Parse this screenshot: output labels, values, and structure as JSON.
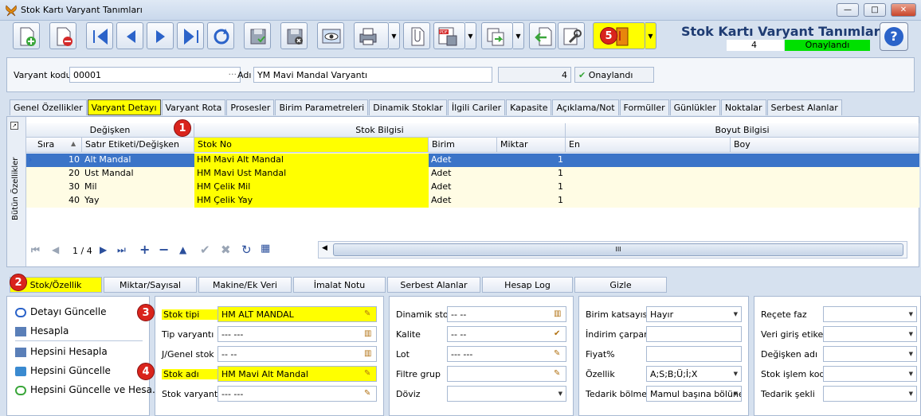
{
  "window": {
    "title": "Stok Kartı Varyant Tanımları",
    "min": "—",
    "max": "□",
    "close": "✕"
  },
  "header": {
    "title": "Stok Kartı Varyant Tanımları",
    "count": "4",
    "status": "Onaylandı",
    "help": "?"
  },
  "form": {
    "code_label": "Varyant kodu",
    "code_value": "00001",
    "name_label": "Adı",
    "name_value": "YM Mavi Mandal Varyantı",
    "count_value": "4",
    "approved_label": "Onaylandı",
    "ellipsis": "···"
  },
  "tabs": [
    "Genel Özellikler",
    "Varyant Detayı",
    "Varyant Rota",
    "Prosesler",
    "Birim Parametreleri",
    "Dinamik Stoklar",
    "İlgili Cariler",
    "Kapasite",
    "Açıklama/Not",
    "Formüller",
    "Günlükler",
    "Noktalar",
    "Serbest Alanlar"
  ],
  "grid": {
    "side_label": "Bütün Özellikler",
    "band_degisken": "Değişken",
    "band_stok": "Stok Bilgisi",
    "band_boyut": "Boyut Bilgisi",
    "col_sira": "Sıra",
    "col_satir": "Satır Etiketi/Değişken",
    "col_stokno": "Stok No",
    "col_birim": "Birim",
    "col_miktar": "Miktar",
    "col_en": "En",
    "col_boy": "Boy",
    "rows": [
      {
        "sira": "10",
        "etiket": "Alt Mandal",
        "stokno": "HM Mavi Alt Mandal",
        "birim": "Adet",
        "miktar": "1"
      },
      {
        "sira": "20",
        "etiket": "Ust Mandal",
        "stokno": "HM Mavi Ust Mandal",
        "birim": "Adet",
        "miktar": "1"
      },
      {
        "sira": "30",
        "etiket": "Mil",
        "stokno": "HM Çelik Mil",
        "birim": "Adet",
        "miktar": "1"
      },
      {
        "sira": "40",
        "etiket": "Yay",
        "stokno": "HM Çelik Yay",
        "birim": "Adet",
        "miktar": "1"
      }
    ],
    "pager": "1 / 4",
    "scroll_grip": "III"
  },
  "badges": [
    "1",
    "2",
    "3",
    "4",
    "5"
  ],
  "bottom_tabs": [
    "Stok/Özellik",
    "Miktar/Sayısal",
    "Makine/Ek Veri",
    "İmalat Notu",
    "Serbest Alanlar",
    "Hesap Log",
    "Gizle"
  ],
  "actions": [
    "Detayı Güncelle",
    "Hesapla",
    "Hepsini Hesapla",
    "Hepsini Güncelle",
    "Hepsini Güncelle ve Hesa..."
  ],
  "panel1": [
    {
      "label": "Stok tipi",
      "value": "HM ALT MANDAL"
    },
    {
      "label": "Tip varyantı",
      "value": "--- ---"
    },
    {
      "label": "J/Genel stok",
      "value": "-- --"
    },
    {
      "label": "Stok adı",
      "value": "HM Mavi Alt Mandal"
    },
    {
      "label": "Stok varyantı",
      "value": "--- ---"
    }
  ],
  "panel2": [
    {
      "label": "Dinamik stok",
      "value": "-- --"
    },
    {
      "label": "Kalite",
      "value": "-- --"
    },
    {
      "label": "Lot",
      "value": "--- ---"
    },
    {
      "label": "Filtre grup",
      "value": ""
    },
    {
      "label": "Döviz",
      "value": ""
    }
  ],
  "panel3": [
    {
      "label": "Birim katsayısı",
      "value": "Hayır"
    },
    {
      "label": "İndirim çarpanı",
      "value": ""
    },
    {
      "label": "Fiyat%",
      "value": ""
    },
    {
      "label": "Özellik",
      "value": "A;S;B;Ü;İ;X"
    },
    {
      "label": "Tedarik bölme",
      "value": "Mamul başına bölüne"
    }
  ],
  "panel4": [
    {
      "label": "Reçete faz",
      "value": ""
    },
    {
      "label": "Veri giriş etiketi",
      "value": ""
    },
    {
      "label": "Değişken adı",
      "value": ""
    },
    {
      "label": "Stok işlem kodu",
      "value": ""
    },
    {
      "label": "Tedarik şekli",
      "value": ""
    }
  ],
  "colors": {
    "highlight": "#ffff00",
    "badge": "#d9241c",
    "approved": "#00e000",
    "selected_row": "#3b74c8"
  }
}
